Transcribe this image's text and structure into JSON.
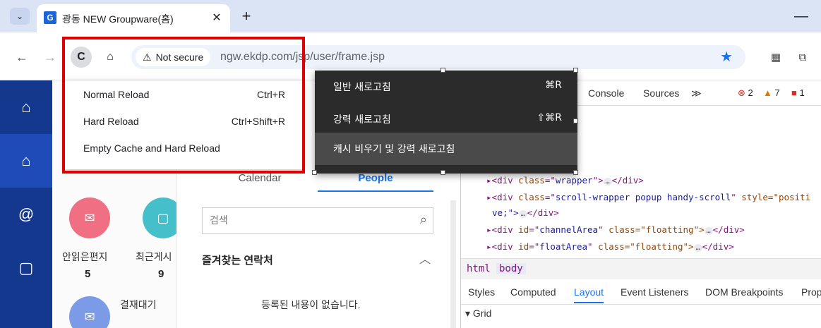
{
  "tabstrip": {
    "tab_title": "광동 NEW Groupware(홈)",
    "favicon_letter": "G",
    "close_glyph": "✕",
    "new_tab_glyph": "+",
    "menu_glyph": "⌄",
    "minimize_glyph": "—"
  },
  "toolbar": {
    "back_glyph": "←",
    "forward_glyph": "→",
    "reload_glyph": "C",
    "home_glyph": "⌂",
    "not_secure_label": "Not secure",
    "url": "ngw.ekdp.com/jsp/user/frame.jsp",
    "star_glyph": "★"
  },
  "reload_menu": {
    "items": [
      {
        "label": "Normal Reload",
        "shortcut": "Ctrl+R"
      },
      {
        "label": "Hard Reload",
        "shortcut": "Ctrl+Shift+R"
      },
      {
        "label": "Empty Cache and Hard Reload",
        "shortcut": ""
      }
    ]
  },
  "dark_menu": {
    "items": [
      {
        "label": "일반 새로고침",
        "shortcut": "⌘R"
      },
      {
        "label": "강력 새로고침",
        "shortcut": "⇧⌘R"
      },
      {
        "label": "캐시 비우기 및 강력 새로고침",
        "shortcut": ""
      }
    ]
  },
  "rail": {
    "items": [
      "home-icon",
      "home-outline-icon",
      "at-icon",
      "briefcase-icon"
    ]
  },
  "page": {
    "unread_label": "안읽은편지",
    "unread_count": "5",
    "recent_label": "최근게시",
    "recent_count": "9",
    "approval_label": "결재대기",
    "tab_calendar": "Calendar",
    "tab_people": "People",
    "search_placeholder": "검색",
    "favorites_title": "즐겨찾는 연락처",
    "empty_text": "등록된 내용이 없습니다."
  },
  "devtools": {
    "tabs": [
      "Console",
      "Sources",
      "≫"
    ],
    "errors": "2",
    "warnings": "7",
    "issues": "1",
    "code_lines": [
      {
        "tag": "div",
        "attr": "class",
        "value": "wrapper",
        "suffix": ""
      },
      {
        "tag": "div",
        "attr": "class",
        "value": "scroll-wrapper popup handy-scroll",
        "suffix": " style=\"positi"
      },
      {
        "tag": "",
        "attr": "",
        "value": "",
        "suffix": "ve;\">"
      },
      {
        "tag": "div",
        "attr": "id",
        "value": "channelArea",
        "suffix": " class=\"floatting\">"
      },
      {
        "tag": "div",
        "attr": "id",
        "value": "floatArea",
        "suffix": " class=\"floatting\">"
      }
    ],
    "crumbs": [
      "html",
      "body"
    ],
    "style_tabs": [
      "Styles",
      "Computed",
      "Layout",
      "Event Listeners",
      "DOM Breakpoints",
      "Prop"
    ],
    "active_style_tab": "Layout",
    "grid_label": "▾ Grid"
  }
}
